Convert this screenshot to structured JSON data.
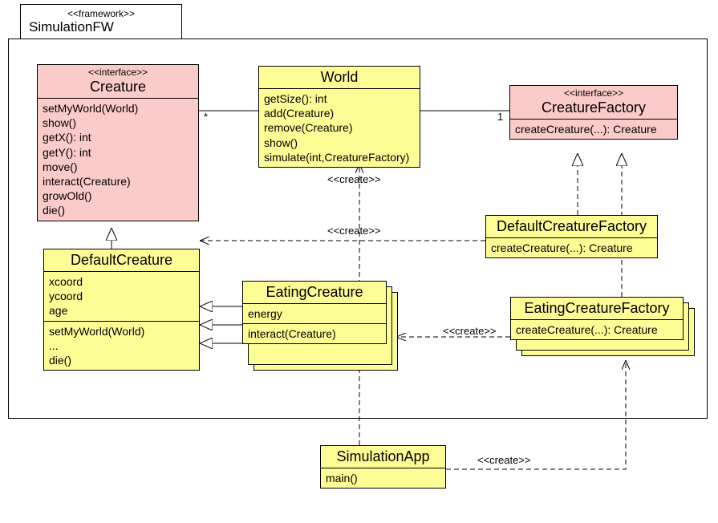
{
  "package": {
    "stereotype": "<<framework>>",
    "name": "SimulationFW"
  },
  "creature": {
    "stereotype": "<<interface>>",
    "name": "Creature",
    "ops": [
      "setMyWorld(World)",
      "show()",
      "getX(): int",
      "getY(): int",
      "move()",
      "interact(Creature)",
      "growOld()",
      "die()"
    ]
  },
  "world": {
    "name": "World",
    "ops": [
      "getSize(): int",
      "add(Creature)",
      "remove(Creature)",
      "show()",
      "simulate(int,CreatureFactory)"
    ]
  },
  "cfactory": {
    "stereotype": "<<interface>>",
    "name": "CreatureFactory",
    "ops": [
      "createCreature(...): Creature"
    ]
  },
  "defcreature": {
    "name": "DefaultCreature",
    "attrs": [
      "xcoord",
      "ycoord",
      "age"
    ],
    "ops": [
      "setMyWorld(World)",
      "...",
      "die()"
    ]
  },
  "eatcreature": {
    "name": "EatingCreature",
    "attrs": [
      "energy"
    ],
    "ops": [
      "interact(Creature)"
    ]
  },
  "defcfactory": {
    "name": "DefaultCreatureFactory",
    "ops": [
      "createCreature(...): Creature"
    ]
  },
  "eatcfactory": {
    "name": "EatingCreatureFactory",
    "ops": [
      "createCreature(...): Creature"
    ]
  },
  "simapp": {
    "name": "SimulationApp",
    "ops": [
      "main()"
    ]
  },
  "labels": {
    "star": "*",
    "one": "1",
    "create": "<<create>>"
  }
}
